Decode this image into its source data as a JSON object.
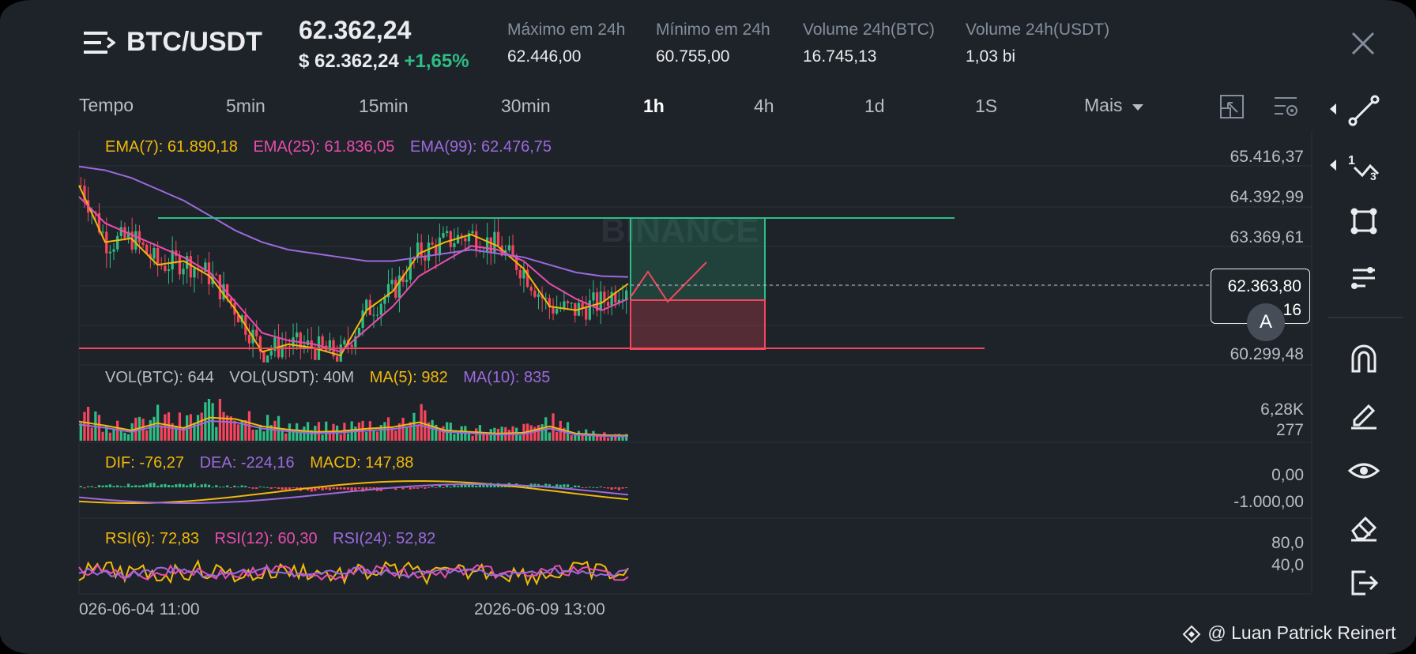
{
  "header": {
    "pair": "BTC/USDT",
    "last_price": "62.362,24",
    "usd_price": "$ 62.362,24",
    "change": "+1,65%",
    "stats": [
      {
        "label": "Máximo em 24h",
        "value": "62.446,00"
      },
      {
        "label": "Mínimo em 24h",
        "value": "60.755,00"
      },
      {
        "label": "Volume 24h(BTC)",
        "value": "16.745,13"
      },
      {
        "label": "Volume 24h(USDT)",
        "value": "1,03 bi"
      }
    ]
  },
  "timeframes": {
    "label": "Tempo",
    "items": [
      "5min",
      "15min",
      "30min",
      "1h",
      "4h",
      "1d",
      "1S"
    ],
    "active": "1h",
    "more": "Mais"
  },
  "indicators": {
    "ema7": "EMA(7): 61.890,18",
    "ema25": "EMA(25): 61.836,05",
    "ema99": "EMA(99): 62.476,75",
    "vol_btc": "VOL(BTC): 644",
    "vol_usdt": "VOL(USDT): 40M",
    "ma5": "MA(5): 982",
    "ma10": "MA(10): 835",
    "dif": "DIF: -76,27",
    "dea": "DEA: -224,16",
    "macd": "MACD: 147,88",
    "rsi6": "RSI(6): 72,83",
    "rsi12": "RSI(12): 60,30",
    "rsi24": "RSI(24): 52,82"
  },
  "price_axis": [
    "65.416,37",
    "64.392,99",
    "63.369,61",
    "60.299,48"
  ],
  "volume_axis": [
    "6,28K",
    "277"
  ],
  "macd_axis": [
    "0,00",
    "-1.000,00"
  ],
  "rsi_axis": [
    "80,0",
    "40,0"
  ],
  "current_price": {
    "price": "62.363,80",
    "countdown": "16"
  },
  "a_button": "A",
  "dates": [
    "026-06-04 11:00",
    "2026-06-09 13:00"
  ],
  "watermark_binance": "BINANCE",
  "credit": "@ Luan Patrick Reinert",
  "colors": {
    "background": "#1e2329",
    "up": "#2ebd85",
    "down": "#f6465d",
    "ema7": "#f0b90b",
    "ema25": "#e94dae",
    "ema99": "#9c6ade"
  },
  "chart_data": [
    {
      "type": "line",
      "title": "",
      "description_series": "EMA overlays on 1h candles",
      "series": [
        {
          "name": "EMA(7)",
          "values": [
            64900,
            63400,
            63500,
            62800,
            62900,
            62500,
            61600,
            60500,
            60700,
            60600,
            60400,
            61600,
            62100,
            63100,
            63400,
            63600,
            63300,
            62700,
            61700,
            61600,
            61800,
            62300
          ]
        },
        {
          "name": "EMA(25)",
          "values": [
            64600,
            63900,
            63600,
            63300,
            63000,
            62600,
            61800,
            61000,
            60800,
            60700,
            60500,
            61100,
            61700,
            62500,
            62900,
            63300,
            63200,
            62900,
            62300,
            61900,
            61600,
            61900
          ]
        },
        {
          "name": "EMA(99)",
          "values": [
            65400,
            65300,
            65100,
            64800,
            64500,
            64100,
            63700,
            63400,
            63200,
            63100,
            63000,
            62900,
            62900,
            63000,
            63100,
            63200,
            63100,
            63000,
            62800,
            62600,
            62500,
            62480
          ]
        }
      ],
      "ylim": [
        60299.48,
        65416.37
      ]
    },
    {
      "type": "bar",
      "title": "",
      "categories_count": 22,
      "values": [
        2400,
        1900,
        1300,
        2200,
        1600,
        2900,
        2700,
        1800,
        1400,
        1100,
        1200,
        1500,
        1700,
        2300,
        1300,
        1100,
        900,
        1000,
        1800,
        900,
        700,
        644
      ],
      "ylim": [
        277,
        6280
      ]
    }
  ]
}
